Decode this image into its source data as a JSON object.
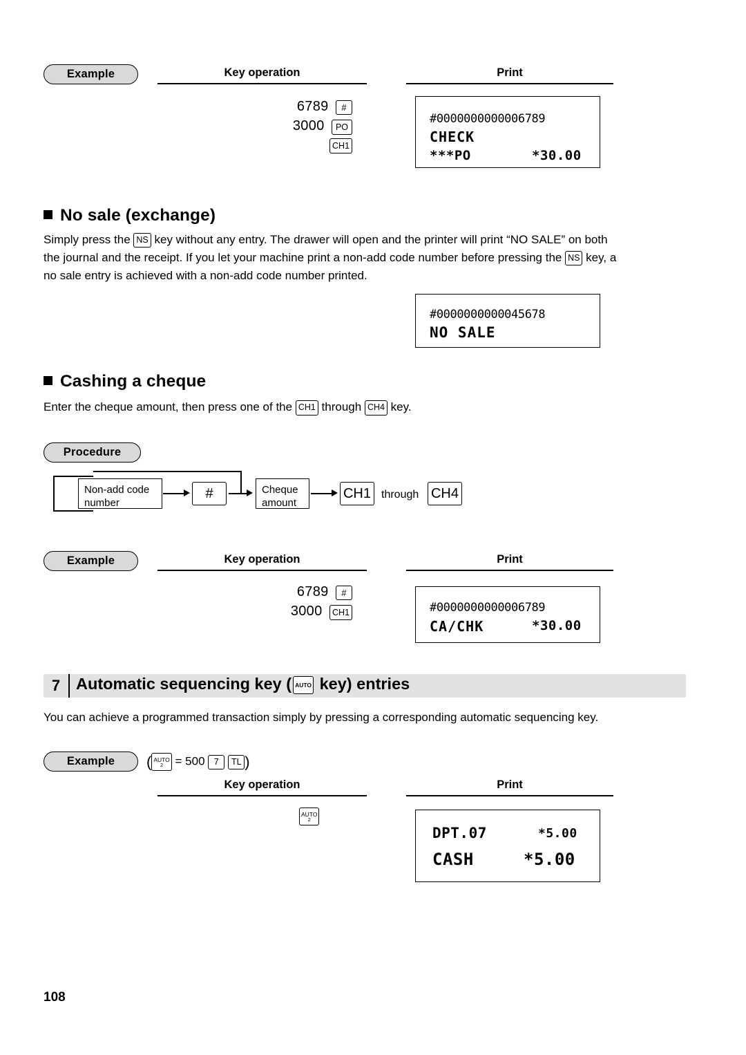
{
  "page": {
    "number": "108"
  },
  "section_po_example": {
    "example_label": "Example",
    "key_operation_header": "Key operation",
    "print_header": "Print",
    "keys": [
      {
        "amount": "6789",
        "key": "#"
      },
      {
        "amount": "3000",
        "key": "PO"
      },
      {
        "amount": "",
        "key": "CH1"
      }
    ],
    "print": {
      "line1": "#0000000000006789",
      "line2": "CHECK",
      "line3_left": "***PO",
      "line3_right": "*30.00"
    }
  },
  "no_sale": {
    "title": "No sale (exchange)",
    "text_part1": "Simply press the ",
    "key_ns": "NS",
    "text_part2": " key without any entry.  The drawer will open and the printer will print “NO SALE” on both",
    "text_part3": "the journal and the receipt.  If you let your machine print a non-add code number before pressing the ",
    "text_part4": " key, a",
    "text_part5": "no sale entry is achieved with a non-add code number printed.",
    "print": {
      "line1": "#0000000000045678",
      "line2": "NO SALE"
    }
  },
  "cashing_cheque": {
    "title": "Cashing a cheque",
    "text_part1": "Enter the cheque amount, then press one of the ",
    "key_ch1": "CH1",
    "text_part2": " through ",
    "key_ch4": "CH4",
    "text_part3": " key.",
    "procedure_label": "Procedure",
    "flow": {
      "box1_line1": "Non-add code",
      "box1_line2": "number",
      "key_hash": "#",
      "box2_line1": "Cheque",
      "box2_line2": "amount",
      "key_ch1": "CH1",
      "through": "through",
      "key_ch4": "CH4"
    },
    "example_label": "Example",
    "key_operation_header": "Key operation",
    "print_header": "Print",
    "keys": [
      {
        "amount": "6789",
        "key": "#"
      },
      {
        "amount": "3000",
        "key": "CH1"
      }
    ],
    "print": {
      "line1": "#0000000000006789",
      "line2_left": "CA/CHK",
      "line2_right": "*30.00"
    }
  },
  "chapter": {
    "number": "7",
    "title_part1": "Automatic sequencing key (",
    "key_auto": "AUTO",
    "title_part2": " key) entries",
    "intro": "You can achieve a programmed transaction simply by pressing a corresponding automatic sequencing key.",
    "example_label": "Example",
    "example_formula_open": "(",
    "example_key_auto": "AUTO",
    "example_key_auto_sub": "2",
    "example_eq": " = 500 ",
    "example_key_7": "7",
    "example_key_tl": "TL",
    "example_formula_close": ")",
    "key_operation_header": "Key operation",
    "print_header": "Print",
    "key_auto2": "AUTO",
    "key_auto2_sub": "2",
    "print": {
      "line1_left": "DPT.07",
      "line1_right": "*5.00",
      "line2_left": "CASH",
      "line2_right": "*5.00"
    }
  }
}
